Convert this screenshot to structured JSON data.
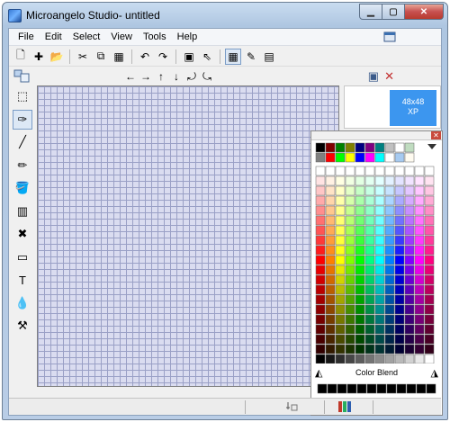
{
  "window": {
    "title": "Microangelo Studio- untitled",
    "controls": {
      "minimize": "▁",
      "maximize": "▢",
      "close": "✕"
    }
  },
  "menu": {
    "items": [
      "File",
      "Edit",
      "Select",
      "View",
      "Tools",
      "Help"
    ]
  },
  "toolbar": {
    "buttons": [
      {
        "name": "new-icon",
        "glyph": "🗋"
      },
      {
        "name": "add-icon",
        "glyph": "✚"
      },
      {
        "name": "open-folder-icon",
        "glyph": "📂"
      },
      {
        "name": "cut-icon",
        "glyph": "✂"
      },
      {
        "name": "copy-icon",
        "glyph": "⧉"
      },
      {
        "name": "paste-icon",
        "glyph": "▦"
      },
      {
        "name": "undo-icon",
        "glyph": "↶"
      },
      {
        "name": "redo-icon",
        "glyph": "↷"
      },
      {
        "name": "image-import-icon",
        "glyph": "▣"
      },
      {
        "name": "cursor-icon",
        "glyph": "⇖"
      },
      {
        "name": "grid-toggle-icon",
        "glyph": "▦"
      },
      {
        "name": "pencils-icon",
        "glyph": "✎"
      },
      {
        "name": "test-icon",
        "glyph": "▤"
      }
    ]
  },
  "toolbar2": {
    "arrows": [
      "←",
      "→",
      "↑",
      "↓",
      "⤾",
      "⤿"
    ],
    "right_icons": [
      "▣",
      "✕"
    ]
  },
  "tools": [
    {
      "name": "select-rect-tool",
      "glyph": "⬚"
    },
    {
      "name": "lasso-tool",
      "glyph": "✑"
    },
    {
      "name": "line-tool",
      "glyph": "╱"
    },
    {
      "name": "pencil-tool",
      "glyph": "✏"
    },
    {
      "name": "fill-tool",
      "glyph": "🪣"
    },
    {
      "name": "gradient-tool",
      "glyph": "▥"
    },
    {
      "name": "recolor-tool",
      "glyph": "✖"
    },
    {
      "name": "shape-tool",
      "glyph": "▭"
    },
    {
      "name": "text-tool",
      "glyph": "T"
    },
    {
      "name": "eyedropper-tool",
      "glyph": "💧"
    },
    {
      "name": "effects-tool",
      "glyph": "⚒"
    }
  ],
  "preview": {
    "tile_line1": "48x48",
    "tile_line2": "XP",
    "tile_color": "#3c96ef"
  },
  "palette": {
    "close_glyph": "✕",
    "blend_label": "Color Blend",
    "top_row": [
      "#000000",
      "#800000",
      "#008000",
      "#808000",
      "#000080",
      "#800080",
      "#008080",
      "#c0c0c0",
      "#ffffff",
      "#c0dcc0"
    ],
    "top_row2": [
      "#808080",
      "#ff0000",
      "#00ff00",
      "#ffff00",
      "#0000ff",
      "#ff00ff",
      "#00ffff",
      "#ffffff",
      "#a6caf0",
      "#fffbf0"
    ],
    "hues": [
      "#ff0000",
      "#ff8000",
      "#ffff00",
      "#80ff00",
      "#00ff00",
      "#00ff80",
      "#00ffff",
      "#0080ff",
      "#0000ff",
      "#8000ff",
      "#ff00ff",
      "#ff0080"
    ]
  },
  "status": {}
}
